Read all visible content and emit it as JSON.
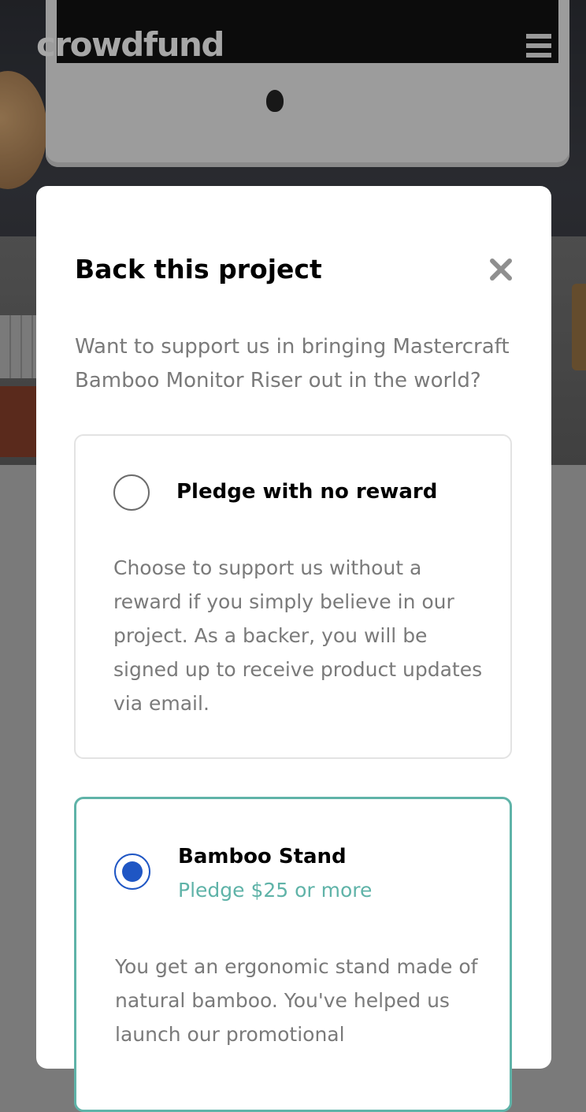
{
  "header": {
    "logo_text": "crowdfund",
    "menu_icon": "hamburger-menu-icon"
  },
  "modal": {
    "title": "Back this project",
    "close_icon": "close-icon",
    "description": "Want to support us in bringing Mastercraft Bamboo Monitor Riser out in the world?",
    "options": [
      {
        "title": "Pledge with no reward",
        "price": "",
        "description": "Choose to support us without a reward if you simply believe in our project. As a backer, you will be signed up to receive product updates via email.",
        "selected": false
      },
      {
        "title": "Bamboo Stand",
        "price": "Pledge $25 or more",
        "description": "You get an ergonomic stand made of natural bamboo. You've helped us launch our promotional",
        "selected": true
      }
    ]
  },
  "colors": {
    "accent": "#5fb3a8",
    "radio_selected": "#1f56c4",
    "text_muted": "#7a7a7a"
  }
}
